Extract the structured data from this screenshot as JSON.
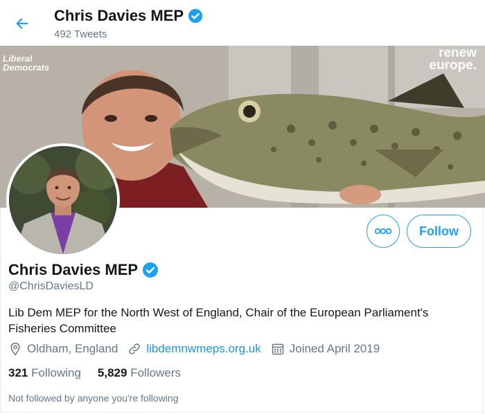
{
  "header": {
    "name": "Chris Davies MEP",
    "tweet_count": "492 Tweets"
  },
  "banner": {
    "brand_left_line1": "Liberal",
    "brand_left_line2": "Democrats",
    "brand_right_line1": "renew",
    "brand_right_line2": "europe."
  },
  "actions": {
    "follow_label": "Follow"
  },
  "profile": {
    "name": "Chris Davies MEP",
    "handle": "@ChrisDaviesLD",
    "bio": "Lib Dem MEP for the North West of England, Chair of the European Parliament's Fisheries Committee",
    "location": "Oldham, England",
    "website": "libdemnwmeps.org.uk",
    "joined": "Joined April 2019"
  },
  "stats": {
    "following_count": "321",
    "following_label": "Following",
    "followers_count": "5,829",
    "followers_label": "Followers"
  },
  "note": "Not followed by anyone you're following",
  "colors": {
    "accent": "#1da1f2",
    "muted": "#657786",
    "text": "#14171a"
  },
  "icons": {
    "back": "back-arrow-icon",
    "verified": "verified-badge-icon",
    "more": "more-dots-icon",
    "location": "location-pin-icon",
    "link": "link-icon",
    "calendar": "calendar-icon"
  }
}
